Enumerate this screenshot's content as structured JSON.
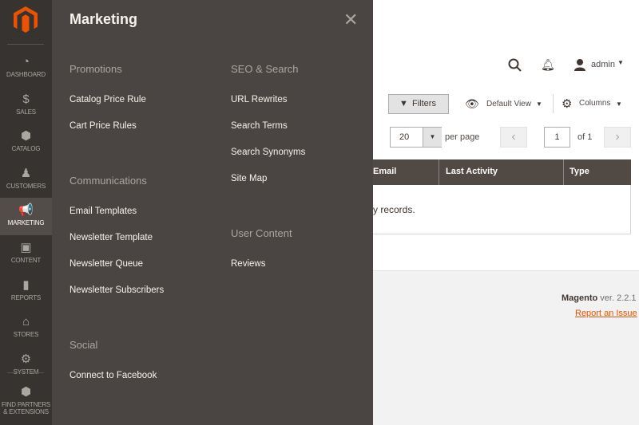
{
  "sidebar": {
    "items": [
      {
        "label": "DASHBOARD",
        "icon": "dashboard-icon",
        "glyph": "◔"
      },
      {
        "label": "SALES",
        "icon": "dollar-icon",
        "glyph": "$"
      },
      {
        "label": "CATALOG",
        "icon": "box-icon",
        "glyph": "⬢"
      },
      {
        "label": "CUSTOMERS",
        "icon": "person-icon",
        "glyph": "♟"
      },
      {
        "label": "MARKETING",
        "icon": "megaphone-icon",
        "glyph": "📢",
        "active": true
      },
      {
        "label": "CONTENT",
        "icon": "layout-icon",
        "glyph": "▣"
      },
      {
        "label": "REPORTS",
        "icon": "bar-chart-icon",
        "glyph": "▮"
      },
      {
        "label": "STORES",
        "icon": "store-icon",
        "glyph": "⌂"
      },
      {
        "label": "SYSTEM",
        "icon": "gear-icon",
        "glyph": "⚙"
      }
    ],
    "partners": {
      "line1": "FIND PARTNERS",
      "line2": "& EXTENSIONS"
    }
  },
  "panel": {
    "title": "Marketing",
    "promotions": {
      "heading": "Promotions",
      "links": [
        "Catalog Price Rule",
        "Cart Price Rules"
      ]
    },
    "communications": {
      "heading": "Communications",
      "links": [
        "Email Templates",
        "Newsletter Template",
        "Newsletter Queue",
        "Newsletter Subscribers"
      ]
    },
    "social": {
      "heading": "Social",
      "links": [
        "Connect to Facebook"
      ]
    },
    "seo": {
      "heading": "SEO & Search",
      "links": [
        "URL Rewrites",
        "Search Terms",
        "Search Synonyms",
        "Site Map"
      ]
    },
    "user_content": {
      "heading": "User Content",
      "links": [
        "Reviews"
      ]
    }
  },
  "header": {
    "user": "admin"
  },
  "toolbar": {
    "filters": "Filters",
    "view": "Default View",
    "columns": "Columns",
    "per_page_value": "20",
    "per_page_label": "per page",
    "page": "1",
    "of": "of 1"
  },
  "grid": {
    "columns": [
      "Email",
      "Last Activity",
      "Type"
    ],
    "empty": "y records."
  },
  "footer": {
    "brand": "Magento",
    "version": " ver. 2.2.1",
    "report": "Report an Issue"
  },
  "colors": {
    "accent": "#eb5202",
    "sidebar": "#373330",
    "panel": "#4a4542",
    "link": "#eb5202"
  }
}
